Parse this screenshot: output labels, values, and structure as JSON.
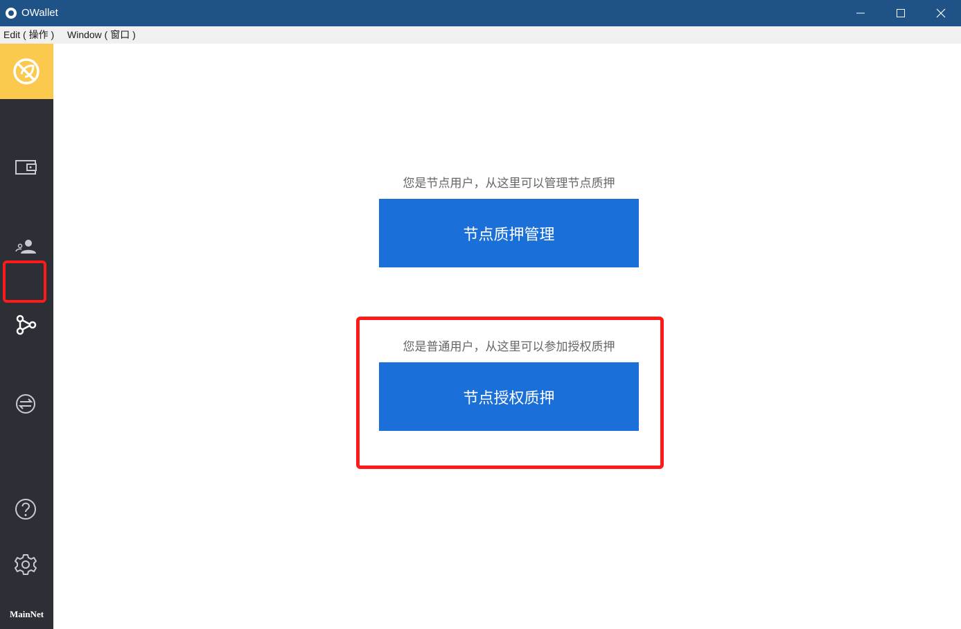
{
  "window": {
    "title": "OWallet",
    "controls": [
      "minimize",
      "maximize",
      "close"
    ]
  },
  "menubar": {
    "items": [
      {
        "label": "Edit ( 操作 )"
      },
      {
        "label": "Window ( 窗口 )"
      }
    ]
  },
  "sidebar": {
    "logo_icon": "owallet-logo-icon",
    "items": [
      {
        "icon": "wallet-icon"
      },
      {
        "icon": "contacts-icon"
      },
      {
        "icon": "node-stake-icon",
        "active": true
      },
      {
        "icon": "exchange-icon"
      },
      {
        "icon": "help-icon"
      },
      {
        "icon": "settings-icon"
      }
    ],
    "network": "MainNet"
  },
  "main": {
    "node_section": {
      "description": "您是节点用户，从这里可以管理节点质押",
      "button_label": "节点质押管理"
    },
    "delegate_section": {
      "description": "您是普通用户，从这里可以参加授权质押",
      "button_label": "节点授权质押"
    }
  },
  "colors": {
    "titlebar": "#1f5286",
    "sidebar": "#2d2f37",
    "logo_bg": "#fbc94d",
    "button": "#1b6fd8",
    "highlight": "#ff1a1a"
  }
}
